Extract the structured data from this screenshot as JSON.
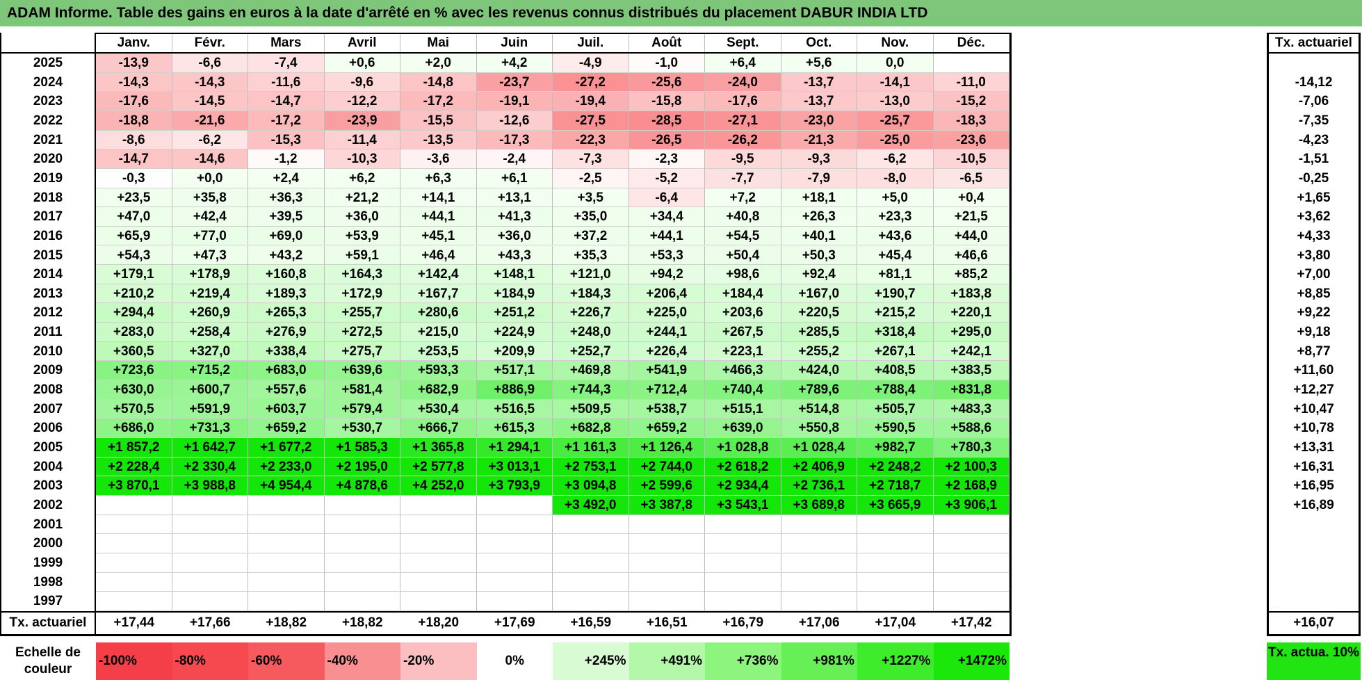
{
  "title": "ADAM Informe. Table des gains en euros à la date d'arrêté en % avec les revenus connus distribués du placement DABUR INDIA LTD",
  "months": [
    "Janv.",
    "Févr.",
    "Mars",
    "Avril",
    "Mai",
    "Juin",
    "Juil.",
    "Août",
    "Sept.",
    "Oct.",
    "Nov.",
    "Déc."
  ],
  "tx_header": "Tx. actuariel",
  "rows": [
    {
      "year": "2025",
      "values": [
        "-13,9",
        "-6,6",
        "-7,4",
        "+0,6",
        "+2,0",
        "+4,2",
        "-4,9",
        "-1,0",
        "+6,4",
        "+5,6",
        "0,0",
        ""
      ],
      "tx": ""
    },
    {
      "year": "2024",
      "values": [
        "-14,3",
        "-14,3",
        "-11,6",
        "-9,6",
        "-14,8",
        "-23,7",
        "-27,2",
        "-25,6",
        "-24,0",
        "-13,7",
        "-14,1",
        "-11,0"
      ],
      "tx": "-14,12"
    },
    {
      "year": "2023",
      "values": [
        "-17,6",
        "-14,5",
        "-14,7",
        "-12,2",
        "-17,2",
        "-19,1",
        "-19,4",
        "-15,8",
        "-17,6",
        "-13,7",
        "-13,0",
        "-15,2"
      ],
      "tx": "-7,06"
    },
    {
      "year": "2022",
      "values": [
        "-18,8",
        "-21,6",
        "-17,2",
        "-23,9",
        "-15,5",
        "-12,6",
        "-27,5",
        "-28,5",
        "-27,1",
        "-23,0",
        "-25,7",
        "-18,3"
      ],
      "tx": "-7,35"
    },
    {
      "year": "2021",
      "values": [
        "-8,6",
        "-6,2",
        "-15,3",
        "-11,4",
        "-13,5",
        "-17,3",
        "-22,3",
        "-26,5",
        "-26,2",
        "-21,3",
        "-25,0",
        "-23,6"
      ],
      "tx": "-4,23"
    },
    {
      "year": "2020",
      "values": [
        "-14,7",
        "-14,6",
        "-1,2",
        "-10,3",
        "-3,6",
        "-2,4",
        "-7,3",
        "-2,3",
        "-9,5",
        "-9,3",
        "-6,2",
        "-10,5"
      ],
      "tx": "-1,51"
    },
    {
      "year": "2019",
      "values": [
        "-0,3",
        "+0,0",
        "+2,4",
        "+6,2",
        "+6,3",
        "+6,1",
        "-2,5",
        "-5,2",
        "-7,7",
        "-7,9",
        "-8,0",
        "-6,5"
      ],
      "tx": "-0,25"
    },
    {
      "year": "2018",
      "values": [
        "+23,5",
        "+35,8",
        "+36,3",
        "+21,2",
        "+14,1",
        "+13,1",
        "+3,5",
        "-6,4",
        "+7,2",
        "+18,1",
        "+5,0",
        "+0,4"
      ],
      "tx": "+1,65"
    },
    {
      "year": "2017",
      "values": [
        "+47,0",
        "+42,4",
        "+39,5",
        "+36,0",
        "+44,1",
        "+41,3",
        "+35,0",
        "+34,4",
        "+40,8",
        "+26,3",
        "+23,3",
        "+21,5"
      ],
      "tx": "+3,62"
    },
    {
      "year": "2016",
      "values": [
        "+65,9",
        "+77,0",
        "+69,0",
        "+53,9",
        "+45,1",
        "+36,0",
        "+37,2",
        "+44,1",
        "+54,5",
        "+40,1",
        "+43,6",
        "+44,0"
      ],
      "tx": "+4,33"
    },
    {
      "year": "2015",
      "values": [
        "+54,3",
        "+47,3",
        "+43,2",
        "+59,1",
        "+46,4",
        "+43,3",
        "+35,3",
        "+53,3",
        "+50,4",
        "+50,3",
        "+45,4",
        "+46,6"
      ],
      "tx": "+3,80"
    },
    {
      "year": "2014",
      "values": [
        "+179,1",
        "+178,9",
        "+160,8",
        "+164,3",
        "+142,4",
        "+148,1",
        "+121,0",
        "+94,2",
        "+98,6",
        "+92,4",
        "+81,1",
        "+85,2"
      ],
      "tx": "+7,00"
    },
    {
      "year": "2013",
      "values": [
        "+210,2",
        "+219,4",
        "+189,3",
        "+172,9",
        "+167,7",
        "+184,9",
        "+184,3",
        "+206,4",
        "+184,4",
        "+167,0",
        "+190,7",
        "+183,8"
      ],
      "tx": "+8,85"
    },
    {
      "year": "2012",
      "values": [
        "+294,4",
        "+260,9",
        "+265,3",
        "+255,7",
        "+280,6",
        "+251,2",
        "+226,7",
        "+225,0",
        "+203,6",
        "+220,5",
        "+215,2",
        "+220,1"
      ],
      "tx": "+9,22"
    },
    {
      "year": "2011",
      "values": [
        "+283,0",
        "+258,4",
        "+276,9",
        "+272,5",
        "+215,0",
        "+224,9",
        "+248,0",
        "+244,1",
        "+267,5",
        "+285,5",
        "+318,4",
        "+295,0"
      ],
      "tx": "+9,18"
    },
    {
      "year": "2010",
      "values": [
        "+360,5",
        "+327,0",
        "+338,4",
        "+275,7",
        "+253,5",
        "+209,9",
        "+252,7",
        "+226,4",
        "+223,1",
        "+255,2",
        "+267,1",
        "+242,1"
      ],
      "tx": "+8,77"
    },
    {
      "year": "2009",
      "values": [
        "+723,6",
        "+715,2",
        "+683,0",
        "+639,6",
        "+593,3",
        "+517,1",
        "+469,8",
        "+541,9",
        "+466,3",
        "+424,0",
        "+408,5",
        "+383,5"
      ],
      "tx": "+11,60"
    },
    {
      "year": "2008",
      "values": [
        "+630,0",
        "+600,7",
        "+557,6",
        "+581,4",
        "+682,9",
        "+886,9",
        "+744,3",
        "+712,4",
        "+740,4",
        "+789,6",
        "+788,4",
        "+831,8"
      ],
      "tx": "+12,27"
    },
    {
      "year": "2007",
      "values": [
        "+570,5",
        "+591,9",
        "+603,7",
        "+579,4",
        "+530,4",
        "+516,5",
        "+509,5",
        "+538,7",
        "+515,1",
        "+514,8",
        "+505,7",
        "+483,3"
      ],
      "tx": "+10,47"
    },
    {
      "year": "2006",
      "values": [
        "+686,0",
        "+731,3",
        "+659,2",
        "+530,7",
        "+666,7",
        "+615,3",
        "+682,8",
        "+659,2",
        "+639,0",
        "+550,8",
        "+590,5",
        "+588,6"
      ],
      "tx": "+10,78"
    },
    {
      "year": "2005",
      "values": [
        "+1 857,2",
        "+1 642,7",
        "+1 677,2",
        "+1 585,3",
        "+1 365,8",
        "+1 294,1",
        "+1 161,3",
        "+1 126,4",
        "+1 028,8",
        "+1 028,4",
        "+982,7",
        "+780,3"
      ],
      "tx": "+13,31"
    },
    {
      "year": "2004",
      "values": [
        "+2 228,4",
        "+2 330,4",
        "+2 233,0",
        "+2 195,0",
        "+2 577,8",
        "+3 013,1",
        "+2 753,1",
        "+2 744,0",
        "+2 618,2",
        "+2 406,9",
        "+2 248,2",
        "+2 100,3"
      ],
      "tx": "+16,31"
    },
    {
      "year": "2003",
      "values": [
        "+3 870,1",
        "+3 988,8",
        "+4 954,4",
        "+4 878,6",
        "+4 252,0",
        "+3 793,9",
        "+3 094,8",
        "+2 599,6",
        "+2 934,4",
        "+2 736,1",
        "+2 718,7",
        "+2 168,9"
      ],
      "tx": "+16,95"
    },
    {
      "year": "2002",
      "values": [
        "",
        "",
        "",
        "",
        "",
        "",
        "+3 492,0",
        "+3 387,8",
        "+3 543,1",
        "+3 689,8",
        "+3 665,9",
        "+3 906,1"
      ],
      "tx": "+16,89"
    },
    {
      "year": "2001",
      "values": [
        "",
        "",
        "",
        "",
        "",
        "",
        "",
        "",
        "",
        "",
        "",
        ""
      ],
      "tx": ""
    },
    {
      "year": "2000",
      "values": [
        "",
        "",
        "",
        "",
        "",
        "",
        "",
        "",
        "",
        "",
        "",
        ""
      ],
      "tx": ""
    },
    {
      "year": "1999",
      "values": [
        "",
        "",
        "",
        "",
        "",
        "",
        "",
        "",
        "",
        "",
        "",
        ""
      ],
      "tx": ""
    },
    {
      "year": "1998",
      "values": [
        "",
        "",
        "",
        "",
        "",
        "",
        "",
        "",
        "",
        "",
        "",
        ""
      ],
      "tx": ""
    },
    {
      "year": "1997",
      "values": [
        "",
        "",
        "",
        "",
        "",
        "",
        "",
        "",
        "",
        "",
        "",
        ""
      ],
      "tx": ""
    }
  ],
  "footer": {
    "label": "Tx. actuariel",
    "values": [
      "+17,44",
      "+17,66",
      "+18,82",
      "+18,82",
      "+18,20",
      "+17,69",
      "+16,59",
      "+16,51",
      "+16,79",
      "+17,06",
      "+17,04",
      "+17,42"
    ],
    "tx": "+16,07"
  },
  "scale": {
    "label": "Echelle de couleur",
    "items": [
      {
        "text": "-100%",
        "color": "#f43f48",
        "align": "left"
      },
      {
        "text": "-80%",
        "color": "#f5494f",
        "align": "left"
      },
      {
        "text": "-60%",
        "color": "#f65a5f",
        "align": "left"
      },
      {
        "text": "-40%",
        "color": "#f88f90",
        "align": "left"
      },
      {
        "text": "-20%",
        "color": "#fbbfc1",
        "align": "left"
      },
      {
        "text": "0%",
        "color": "#ffffff",
        "align": "center"
      },
      {
        "text": "+245%",
        "color": "#d9fbd4",
        "align": "right"
      },
      {
        "text": "+491%",
        "color": "#b3f7a8",
        "align": "right"
      },
      {
        "text": "+736%",
        "color": "#8df47e",
        "align": "right"
      },
      {
        "text": "+981%",
        "color": "#66f055",
        "align": "right"
      },
      {
        "text": "+1227%",
        "color": "#3fec2c",
        "align": "right"
      },
      {
        "text": "+1472%",
        "color": "#1be80a",
        "align": "right"
      }
    ],
    "tx_label": "Tx. actua. 10%",
    "tx_color": "#22e412"
  },
  "colors": {
    "title_bg": "#7ec67a"
  }
}
